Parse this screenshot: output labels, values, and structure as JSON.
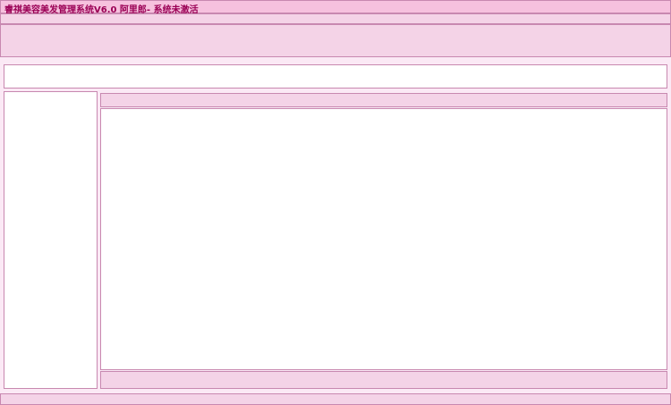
{
  "title": "睿祺美容美发管理系统V6.0 阿里郎- 系统未激活"
}
